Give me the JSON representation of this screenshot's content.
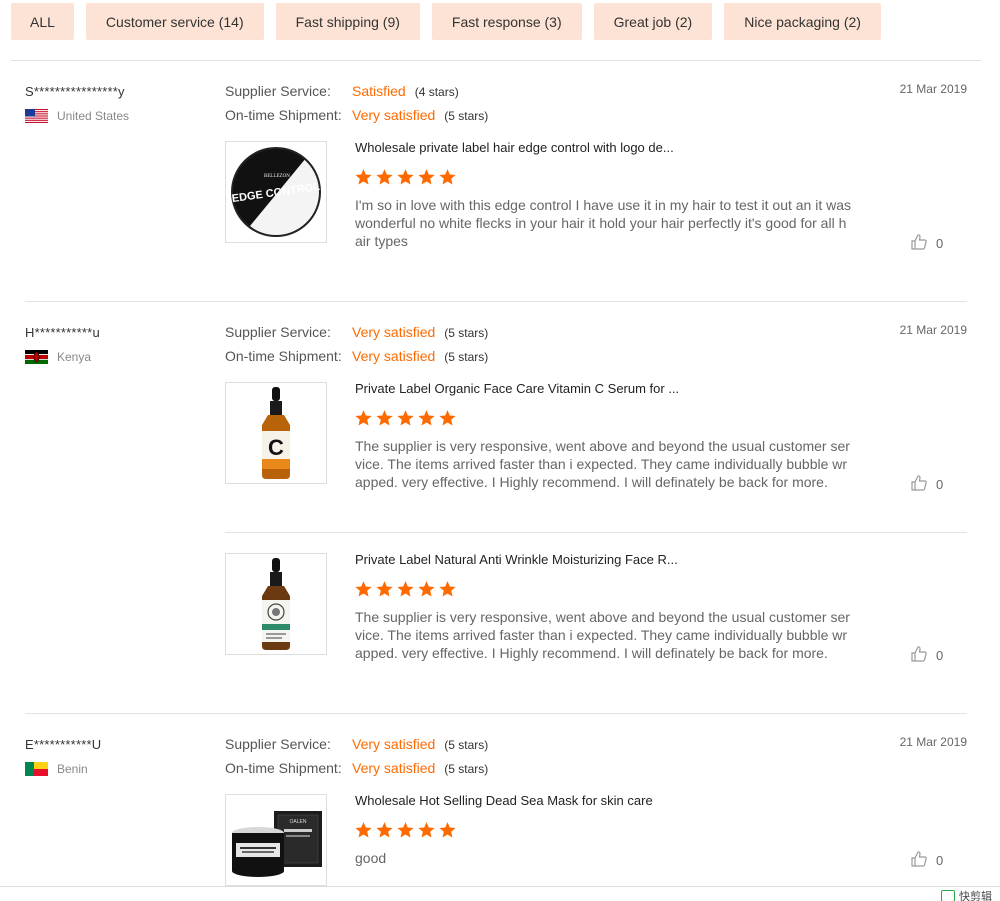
{
  "filters": [
    "ALL",
    "Customer service (14)",
    "Fast shipping (9)",
    "Fast response (3)",
    "Great job (2)",
    "Nice packaging (2)"
  ],
  "labels": {
    "supplier_service": "Supplier Service:",
    "shipment": "On-time Shipment:"
  },
  "reviews": [
    {
      "user": "S****************y",
      "country": "United States",
      "date": "21 Mar 2019",
      "supplier_value": "Satisfied",
      "supplier_stars": "(4 stars)",
      "shipment_value": "Very satisfied",
      "shipment_stars": "(5 stars)",
      "items": [
        {
          "title": "Wholesale private label hair edge control with logo de...",
          "rating": 5,
          "text": "I'm so in love with this edge control I have use it in my hair to test it out an it was wonderful no white flecks in your hair it hold your hair perfectly it's good for all hair types",
          "likes": "0",
          "product_label": "EDGE CONTROL",
          "brand": "BELLEZON"
        }
      ]
    },
    {
      "user": "H***********u",
      "country": "Kenya",
      "date": "21 Mar 2019",
      "supplier_value": "Very satisfied",
      "supplier_stars": "(5 stars)",
      "shipment_value": "Very satisfied",
      "shipment_stars": "(5 stars)",
      "items": [
        {
          "title": "Private Label Organic Face Care Vitamin C Serum for ...",
          "rating": 5,
          "text": "The supplier is very responsive, went above and beyond the usual customer service. The items arrived faster than i expected. They came individually bubble wrapped. very effective. I Highly recommend. I will definately be back for more.",
          "likes": "0",
          "product_label": "C"
        },
        {
          "title": "Private Label Natural Anti Wrinkle Moisturizing Face R...",
          "rating": 5,
          "text": "The supplier is very responsive, went above and beyond the usual customer service. The items arrived faster than i expected. They came individually bubble wrapped. very effective. I Highly recommend. I will definately be back for more.",
          "likes": "0"
        }
      ]
    },
    {
      "user": "E***********U",
      "country": "Benin",
      "date": "21 Mar 2019",
      "supplier_value": "Very satisfied",
      "supplier_stars": "(5 stars)",
      "shipment_value": "Very satisfied",
      "shipment_stars": "(5 stars)",
      "items": [
        {
          "title": "Wholesale Hot Selling Dead Sea Mask for skin care",
          "rating": 5,
          "text": "good",
          "likes": "0",
          "brand": "OALEN"
        }
      ]
    }
  ],
  "footer": {
    "watermark": "快剪辑"
  },
  "colors": {
    "accent": "#ff6a00",
    "chip_bg": "#fde3d5"
  }
}
